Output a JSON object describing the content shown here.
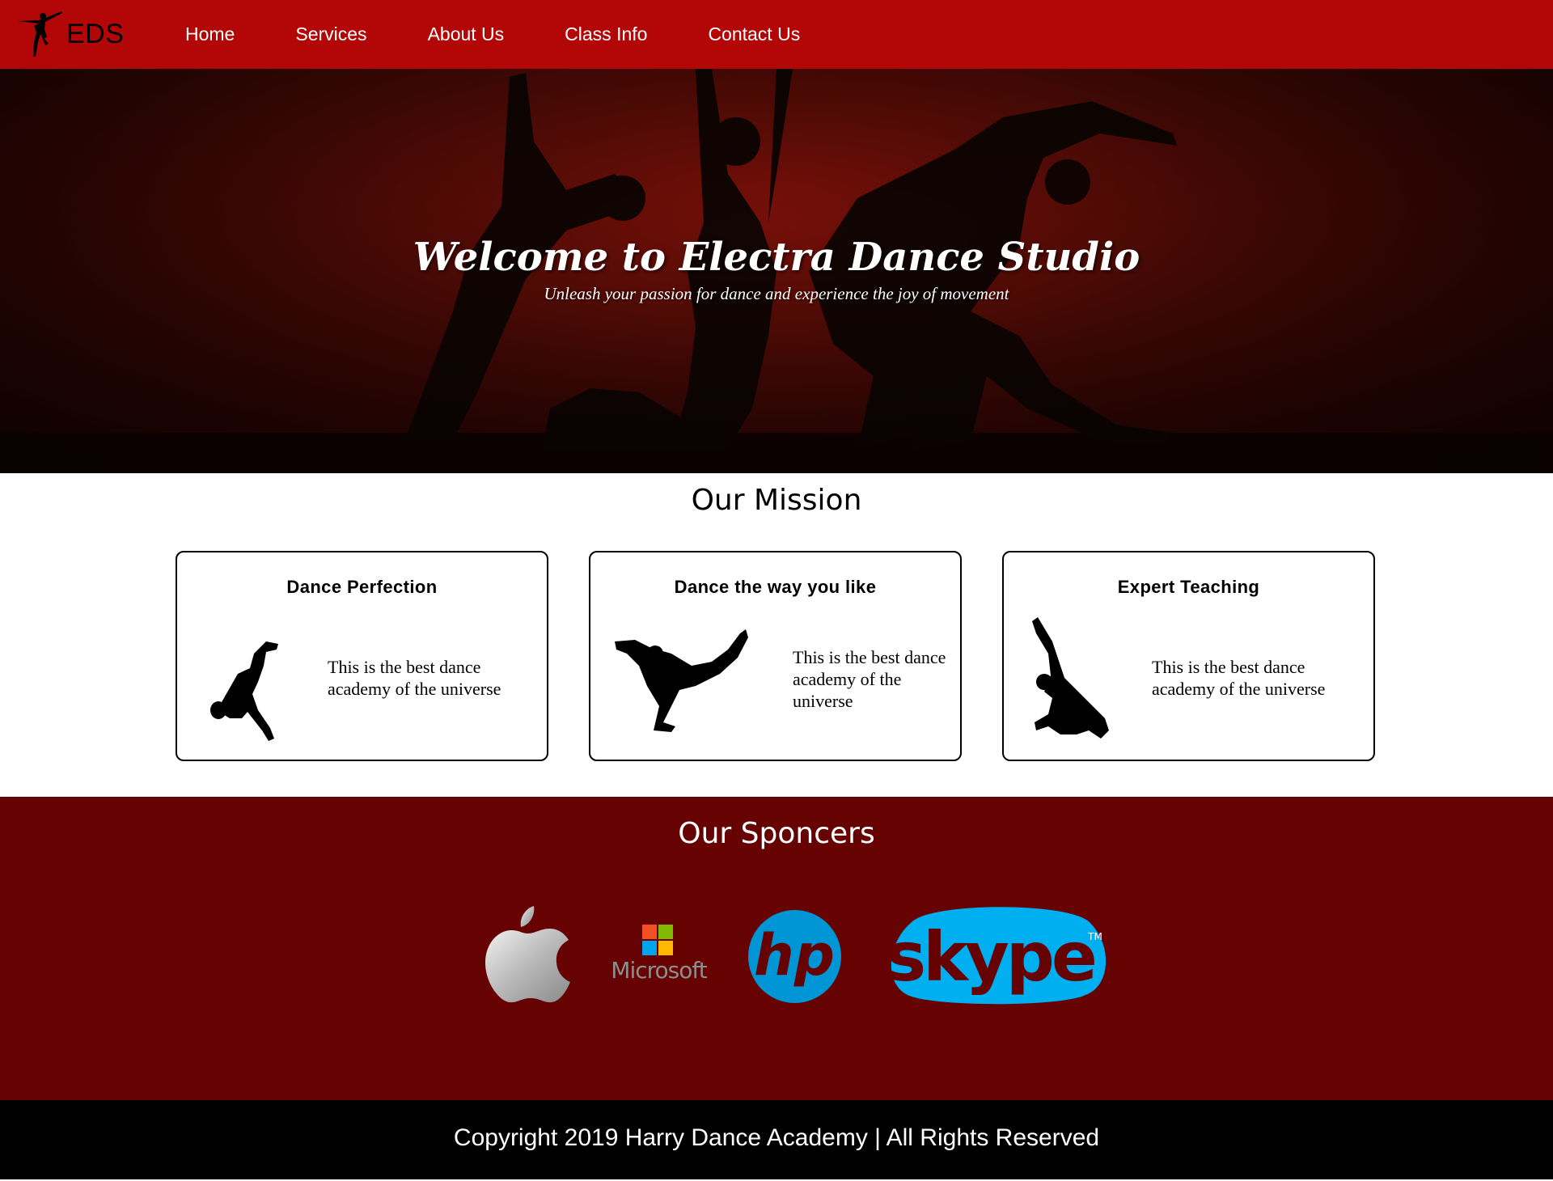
{
  "nav": {
    "logo_text": "EDS",
    "links": [
      "Home",
      "Services",
      "About Us",
      "Class Info",
      "Contact Us"
    ]
  },
  "hero": {
    "title": "Welcome to Electra Dance Studio",
    "subtitle": "Unleash your passion for dance and experience the joy of movement"
  },
  "mission": {
    "title": "Our Mission",
    "cards": [
      {
        "title": "Dance Perfection",
        "text": "This is the best dance academy of the universe",
        "icon": "dancer-flip-icon"
      },
      {
        "title": "Dance the way you like",
        "text": "This is the best dance academy of the universe",
        "icon": "breakdancer-icon"
      },
      {
        "title": "Expert Teaching",
        "text": "This is the best dance academy of the universe",
        "icon": "dancer-crouch-icon"
      }
    ]
  },
  "sponsors": {
    "title": "Our Sponcers",
    "logos": [
      {
        "name": "apple-logo"
      },
      {
        "name": "microsoft-logo",
        "label": "Microsoft"
      },
      {
        "name": "hp-logo",
        "label": "hp"
      },
      {
        "name": "skype-logo",
        "label": "skype",
        "mark": "TM"
      }
    ]
  },
  "colors": {
    "nav": "#b30707",
    "sponsors_bg": "#660202",
    "footer_bg": "#000000"
  },
  "footer": {
    "text": "Copyright 2019 Harry Dance Academy | All Rights Reserved"
  }
}
